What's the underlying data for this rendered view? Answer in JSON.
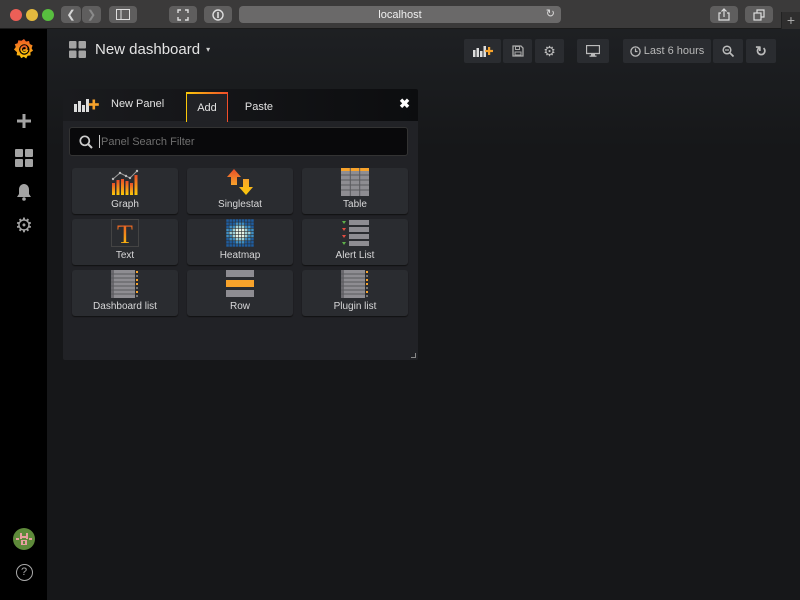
{
  "browser": {
    "url": "localhost",
    "new_tab_label": "+"
  },
  "sidebar": {
    "items": [
      {
        "name": "create",
        "icon": "plus-icon"
      },
      {
        "name": "dashboards",
        "icon": "dashboards-icon"
      },
      {
        "name": "alerting",
        "icon": "bell-icon"
      },
      {
        "name": "configuration",
        "icon": "gear-icon"
      }
    ],
    "help_label": "?"
  },
  "navbar": {
    "title": "New dashboard",
    "caret": "▾",
    "time_range": "Last 6 hours"
  },
  "add_panel": {
    "title": "New Panel",
    "tabs": [
      {
        "label": "Add",
        "active": true
      },
      {
        "label": "Paste",
        "active": false
      }
    ],
    "close_label": "✖",
    "search": {
      "value": "",
      "placeholder": "Panel Search Filter"
    },
    "panel_types": [
      {
        "label": "Graph",
        "icon": "graph-icon"
      },
      {
        "label": "Singlestat",
        "icon": "singlestat-icon"
      },
      {
        "label": "Table",
        "icon": "table-icon"
      },
      {
        "label": "Text",
        "icon": "text-icon"
      },
      {
        "label": "Heatmap",
        "icon": "heatmap-icon"
      },
      {
        "label": "Alert List",
        "icon": "alert-list-icon"
      },
      {
        "label": "Dashboard list",
        "icon": "dashboard-list-icon"
      },
      {
        "label": "Row",
        "icon": "row-icon"
      },
      {
        "label": "Plugin list",
        "icon": "plugin-list-icon"
      }
    ]
  },
  "colors": {
    "accent_yellow": "#fbca0a",
    "accent_orange": "#f24c2a",
    "background": "#161719",
    "card": "#2a2c30"
  }
}
